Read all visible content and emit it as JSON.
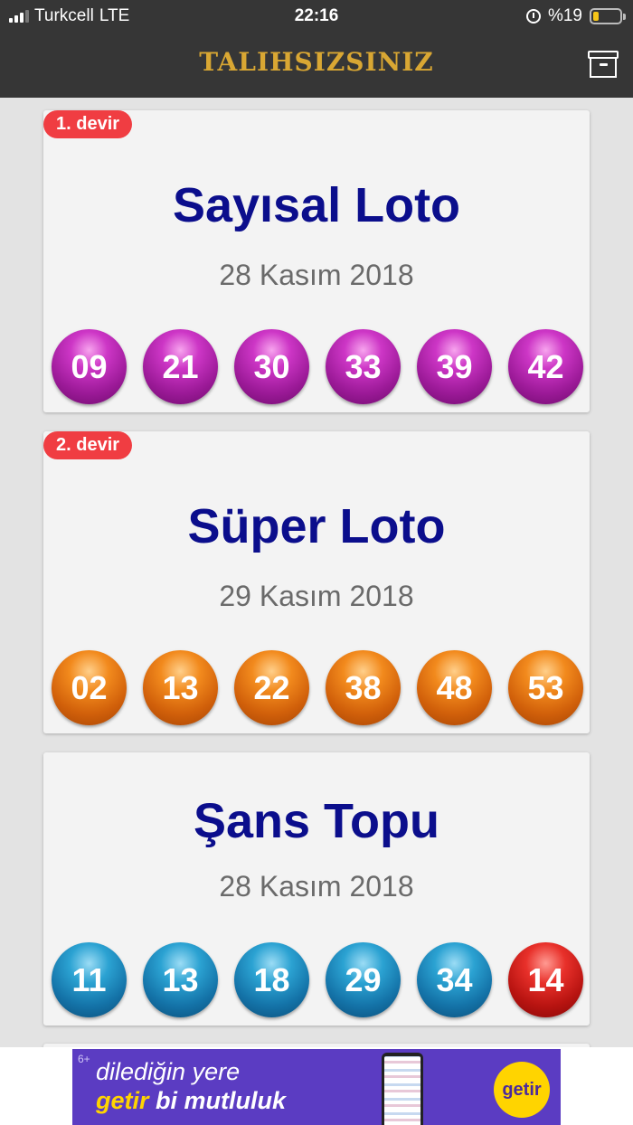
{
  "status_bar": {
    "carrier": "Turkcell",
    "network": "LTE",
    "time": "22:16",
    "battery": "%19"
  },
  "header": {
    "title": "TALIHSIZSINIZ",
    "archive_icon": "archive-box-icon"
  },
  "cards": [
    {
      "badge": "1. devir",
      "title": "Sayısal Loto",
      "date": "28 Kasım 2018",
      "ball_color": "#a5209f",
      "balls": [
        "09",
        "21",
        "30",
        "33",
        "39",
        "42"
      ]
    },
    {
      "badge": "2. devir",
      "title": "Süper Loto",
      "date": "29 Kasım 2018",
      "ball_color": "#e0701a",
      "balls": [
        "02",
        "13",
        "22",
        "38",
        "48",
        "53"
      ]
    },
    {
      "title": "Şans Topu",
      "date": "28 Kasım 2018",
      "ball_color": "#1a86bd",
      "extra_ball_color": "#cc1f1a",
      "balls": [
        "11",
        "13",
        "18",
        "29",
        "34"
      ],
      "extra_ball": "14"
    }
  ],
  "ad": {
    "age": "6+",
    "line1": "dilediğin yere",
    "line2_brand": "getir",
    "line2_rest": " bi mutluluk",
    "logo": "getir"
  },
  "colors": {
    "header_bg": "#363636",
    "title_gold": "#d9a733",
    "badge_red": "#f03d42",
    "game_title": "#0b0e8c"
  }
}
